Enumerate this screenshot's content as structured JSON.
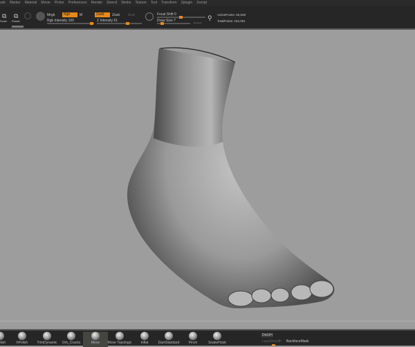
{
  "menu": [
    "ush",
    "Marker",
    "Material",
    "Movie",
    "Picker",
    "Preferences",
    "Render",
    "Stencil",
    "Stroke",
    "Texture",
    "Tool",
    "Transform",
    "Zplugin",
    "Zscript"
  ],
  "toolbar": {
    "scale_label": "Scale",
    "rotate_label": "Rotate",
    "mrgb": "Mrgb",
    "rgb": "Rgb",
    "m": "M",
    "rgb_intensity": "Rgb Intensity 100",
    "zadd": "Zadd",
    "zsub": "Zsub",
    "zcut": "Zcut",
    "z_intensity": "Z Intensity 51",
    "focal_shift": "Focal Shift 0",
    "draw_size": "Draw Size 7",
    "dynamic": "Dynamic",
    "active_points": "ActivePoints: 60,539",
    "total_points": "TotalPoints: 152,001",
    "rgb_intensity_value": 100,
    "z_intensity_value": 51,
    "focal_shift_value": 0,
    "draw_size_value": 7
  },
  "tray": {
    "brushes": [
      "hPolish",
      "hPolish",
      "TrimDynamic",
      "Orb_Cracks",
      "Move",
      "Move Topologic",
      "Inflat",
      "DamStandard",
      "Pinch",
      "SnakeHook"
    ],
    "selected": "Move",
    "deluv": "DelUH",
    "lazy_smooth": "LazySmooth",
    "backface_mask": "BackfaceMask"
  },
  "colors": {
    "accent": "#e88a1a",
    "panel": "#262626",
    "viewport": "#9d9d9d"
  }
}
